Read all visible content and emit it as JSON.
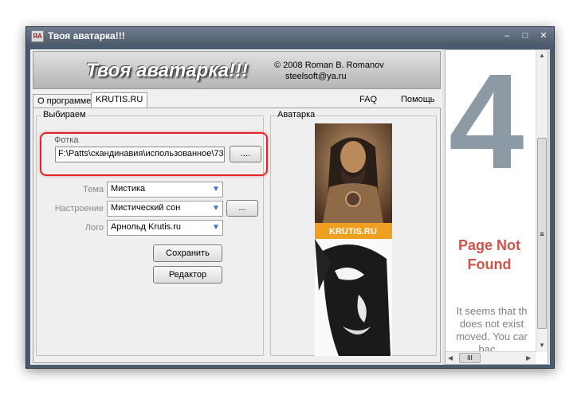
{
  "window": {
    "title": "Твоя аватарка!!!",
    "icon_text": "ЯА",
    "controls": {
      "minimize": "–",
      "maximize": "□",
      "close": "✕"
    }
  },
  "banner": {
    "title": "Твоя аватарка!!!",
    "copyright": "© 2008 Roman B. Romanov",
    "email": "steelsoft@ya.ru"
  },
  "tabs": [
    {
      "label": "О программе",
      "active": false
    },
    {
      "label": "KRUTIS.RU",
      "active": true
    }
  ],
  "menu": {
    "faq": "FAQ",
    "help": "Помощь"
  },
  "choose_group": {
    "label": "Выбираем",
    "photo": {
      "label": "Фотка",
      "path": "F:\\Patts\\скандинавия\\использованное\\73",
      "browse_label": "...."
    },
    "theme": {
      "label": "Тема",
      "value": "Мистика"
    },
    "mood": {
      "label": "Настроение",
      "value": "Мистический сон",
      "more_label": "..."
    },
    "logo": {
      "label": "Лого",
      "value": "Арнольд Krutis.ru"
    },
    "save_label": "Сохранить",
    "editor_label": "Редактор"
  },
  "avatar_group": {
    "label": "Аватарка",
    "banner_text": "KRUTIS.RU"
  },
  "browser_pane": {
    "big_number": "4",
    "title_line1": "Page Not",
    "title_line2": "Found",
    "text_line1": "It seems that th",
    "text_line2": "does not exist",
    "text_line3": "moved. You car",
    "text_line4": "bac",
    "hscroll_thumb": "III",
    "vscroll_thumb": "≡"
  },
  "colors": {
    "highlight": "#e0262a",
    "title_bar": "#4b586a",
    "page_not_found": "#d0524a",
    "big_digit": "#8c9aa5"
  }
}
